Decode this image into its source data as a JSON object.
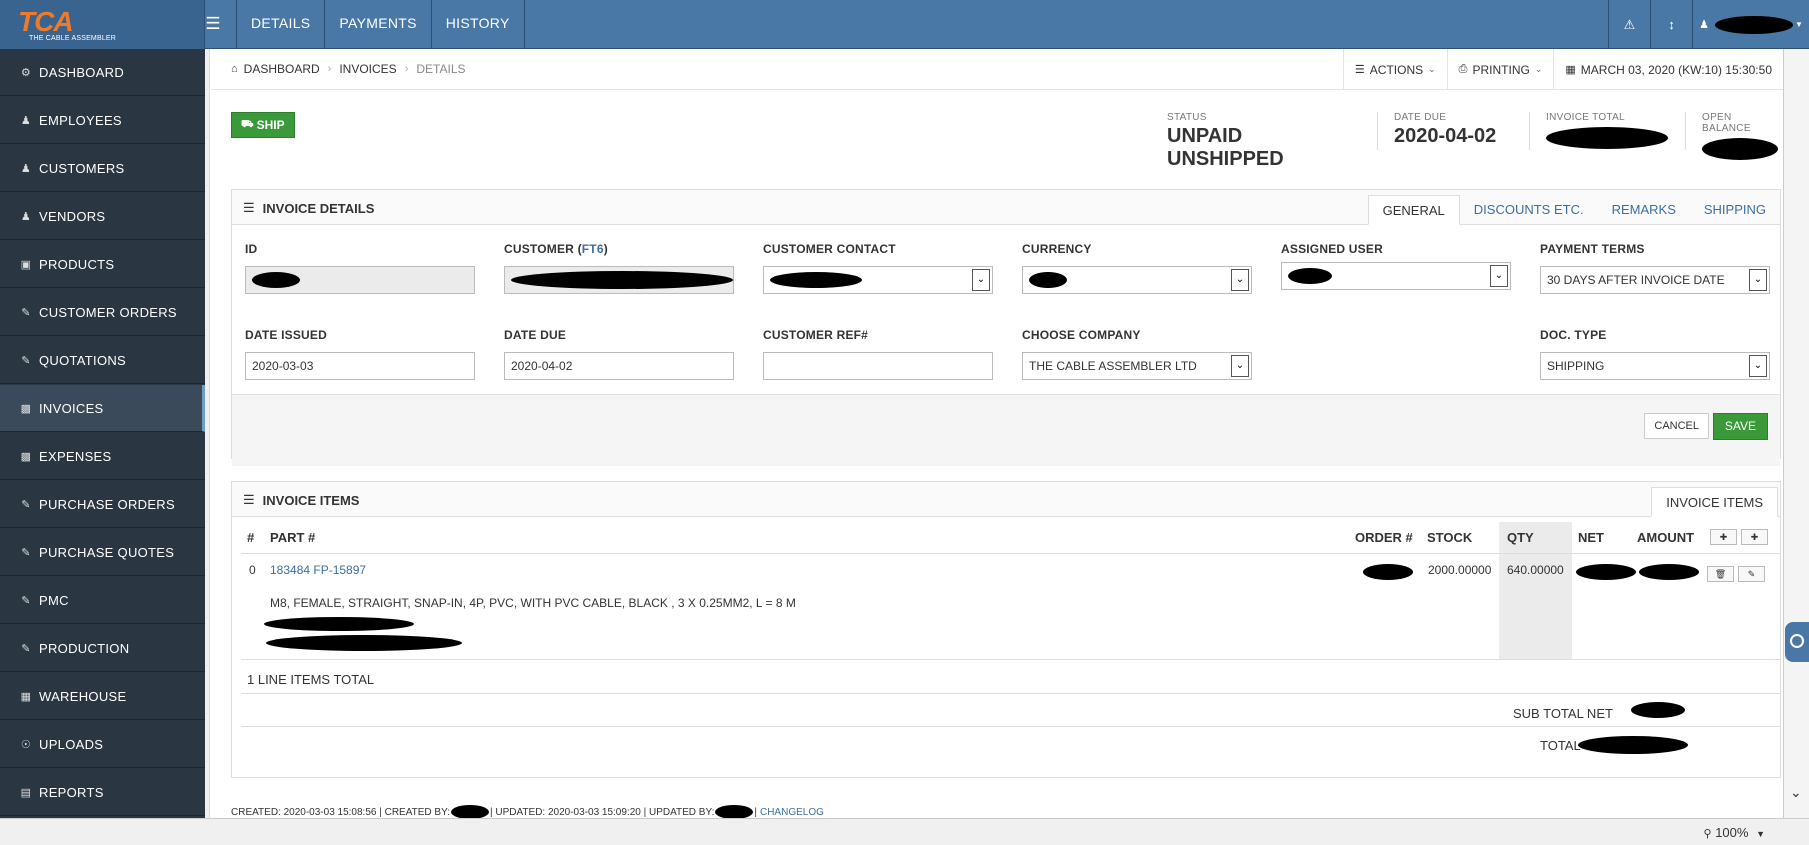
{
  "app": {
    "logo_text": "TCA",
    "logo_subtitle": "THE CABLE ASSEMBLER"
  },
  "topnav": {
    "items": [
      "DETAILS",
      "PAYMENTS",
      "HISTORY"
    ]
  },
  "sidebar": {
    "items": [
      {
        "label": "DASHBOARD",
        "icon": "dashboard-icon"
      },
      {
        "label": "EMPLOYEES",
        "icon": "user-icon"
      },
      {
        "label": "CUSTOMERS",
        "icon": "user-icon"
      },
      {
        "label": "VENDORS",
        "icon": "user-icon"
      },
      {
        "label": "PRODUCTS",
        "icon": "folder-icon"
      },
      {
        "label": "CUSTOMER ORDERS",
        "icon": "edit-icon"
      },
      {
        "label": "QUOTATIONS",
        "icon": "edit-icon"
      },
      {
        "label": "INVOICES",
        "icon": "money-icon"
      },
      {
        "label": "EXPENSES",
        "icon": "money-icon"
      },
      {
        "label": "PURCHASE ORDERS",
        "icon": "edit-icon"
      },
      {
        "label": "PURCHASE QUOTES",
        "icon": "edit-icon"
      },
      {
        "label": "PMC",
        "icon": "edit-icon"
      },
      {
        "label": "PRODUCTION",
        "icon": "edit-icon"
      },
      {
        "label": "WAREHOUSE",
        "icon": "table-icon"
      },
      {
        "label": "UPLOADS",
        "icon": "upload-icon"
      },
      {
        "label": "REPORTS",
        "icon": "chart-icon"
      }
    ]
  },
  "breadcrumb": {
    "items": [
      "DASHBOARD",
      "INVOICES",
      "DETAILS"
    ]
  },
  "toolbar": {
    "actions_label": "ACTIONS",
    "printing_label": "PRINTING",
    "datetime": "MARCH 03, 2020 (KW:10) 15:30:50"
  },
  "ship_button": "SHIP",
  "stats": {
    "status_label": "STATUS",
    "status_value": "UNPAID UNSHIPPED",
    "date_due_label": "DATE DUE",
    "date_due_value": "2020-04-02",
    "invoice_total_label": "INVOICE TOTAL",
    "open_balance_label": "OPEN BALANCE"
  },
  "invoice_details": {
    "title": "INVOICE DETAILS",
    "tabs": [
      "GENERAL",
      "DISCOUNTS ETC.",
      "REMARKS",
      "SHIPPING"
    ],
    "fields": {
      "id_label": "ID",
      "customer_label": "CUSTOMER (",
      "customer_code": "FT6",
      "customer_label_end": ")",
      "customer_contact_label": "CUSTOMER CONTACT",
      "currency_label": "CURRENCY",
      "assigned_user_label": "ASSIGNED USER",
      "payment_terms_label": "PAYMENT TERMS",
      "payment_terms_value": "30 DAYS AFTER INVOICE DATE",
      "date_issued_label": "DATE ISSUED",
      "date_issued_value": "2020-03-03",
      "date_due_label": "DATE DUE",
      "date_due_value": "2020-04-02",
      "customer_ref_label": "CUSTOMER REF#",
      "customer_ref_value": "",
      "choose_company_label": "CHOOSE COMPANY",
      "choose_company_value": "THE CABLE ASSEMBLER LTD",
      "doc_type_label": "DOC. TYPE",
      "doc_type_value": "SHIPPING"
    },
    "cancel_label": "CANCEL",
    "save_label": "SAVE"
  },
  "invoice_items": {
    "title": "INVOICE ITEMS",
    "tab": "INVOICE ITEMS",
    "columns": [
      "#",
      "PART #",
      "ORDER #",
      "STOCK",
      "QTY",
      "NET",
      "AMOUNT"
    ],
    "rows": [
      {
        "index": "0",
        "part": "183484 FP-15897",
        "description": "M8, FEMALE, STRAIGHT, SNAP-IN, 4P, PVC, WITH PVC CABLE, BLACK , 3 X 0.25MM2, L = 8 M",
        "stock": "2000.00000",
        "qty": "640.00000"
      }
    ],
    "line_total": "1 LINE ITEMS TOTAL",
    "subtotal_label": "SUB TOTAL NET",
    "total_label": "TOTAL"
  },
  "footer": {
    "created": "CREATED: 2020-03-03 15:08:56 | CREATED BY:",
    "updated": "| UPDATED: 2020-03-03 15:09:20 | UPDATED BY:",
    "sep": "|",
    "changelog": "CHANGELOG"
  },
  "statusbar": {
    "zoom": "100%"
  }
}
